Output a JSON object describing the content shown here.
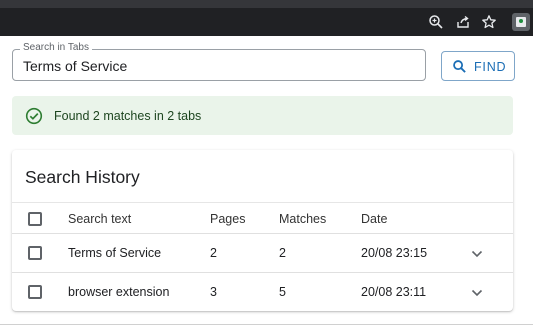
{
  "search": {
    "legend": "Search in Tabs",
    "value": "Terms of Service"
  },
  "find_button": {
    "label": "FIND"
  },
  "alert": {
    "message": "Found 2 matches in 2 tabs"
  },
  "history": {
    "title": "Search History",
    "columns": [
      "Search text",
      "Pages",
      "Matches",
      "Date"
    ],
    "rows": [
      {
        "text": "Terms of Service",
        "pages": "2",
        "matches": "2",
        "date": "20/08 23:15"
      },
      {
        "text": "browser extension",
        "pages": "3",
        "matches": "5",
        "date": "20/08 23:11"
      }
    ]
  },
  "colors": {
    "accent": "#1a6db5",
    "success_bg": "#eaf4ea",
    "success_icon": "#2e7d32",
    "toolbar": "#202124"
  },
  "icons": [
    "zoom-icon",
    "share-icon",
    "bookmark-star-icon",
    "extension-icon",
    "search-icon",
    "check-circle-icon",
    "chevron-down-icon"
  ]
}
